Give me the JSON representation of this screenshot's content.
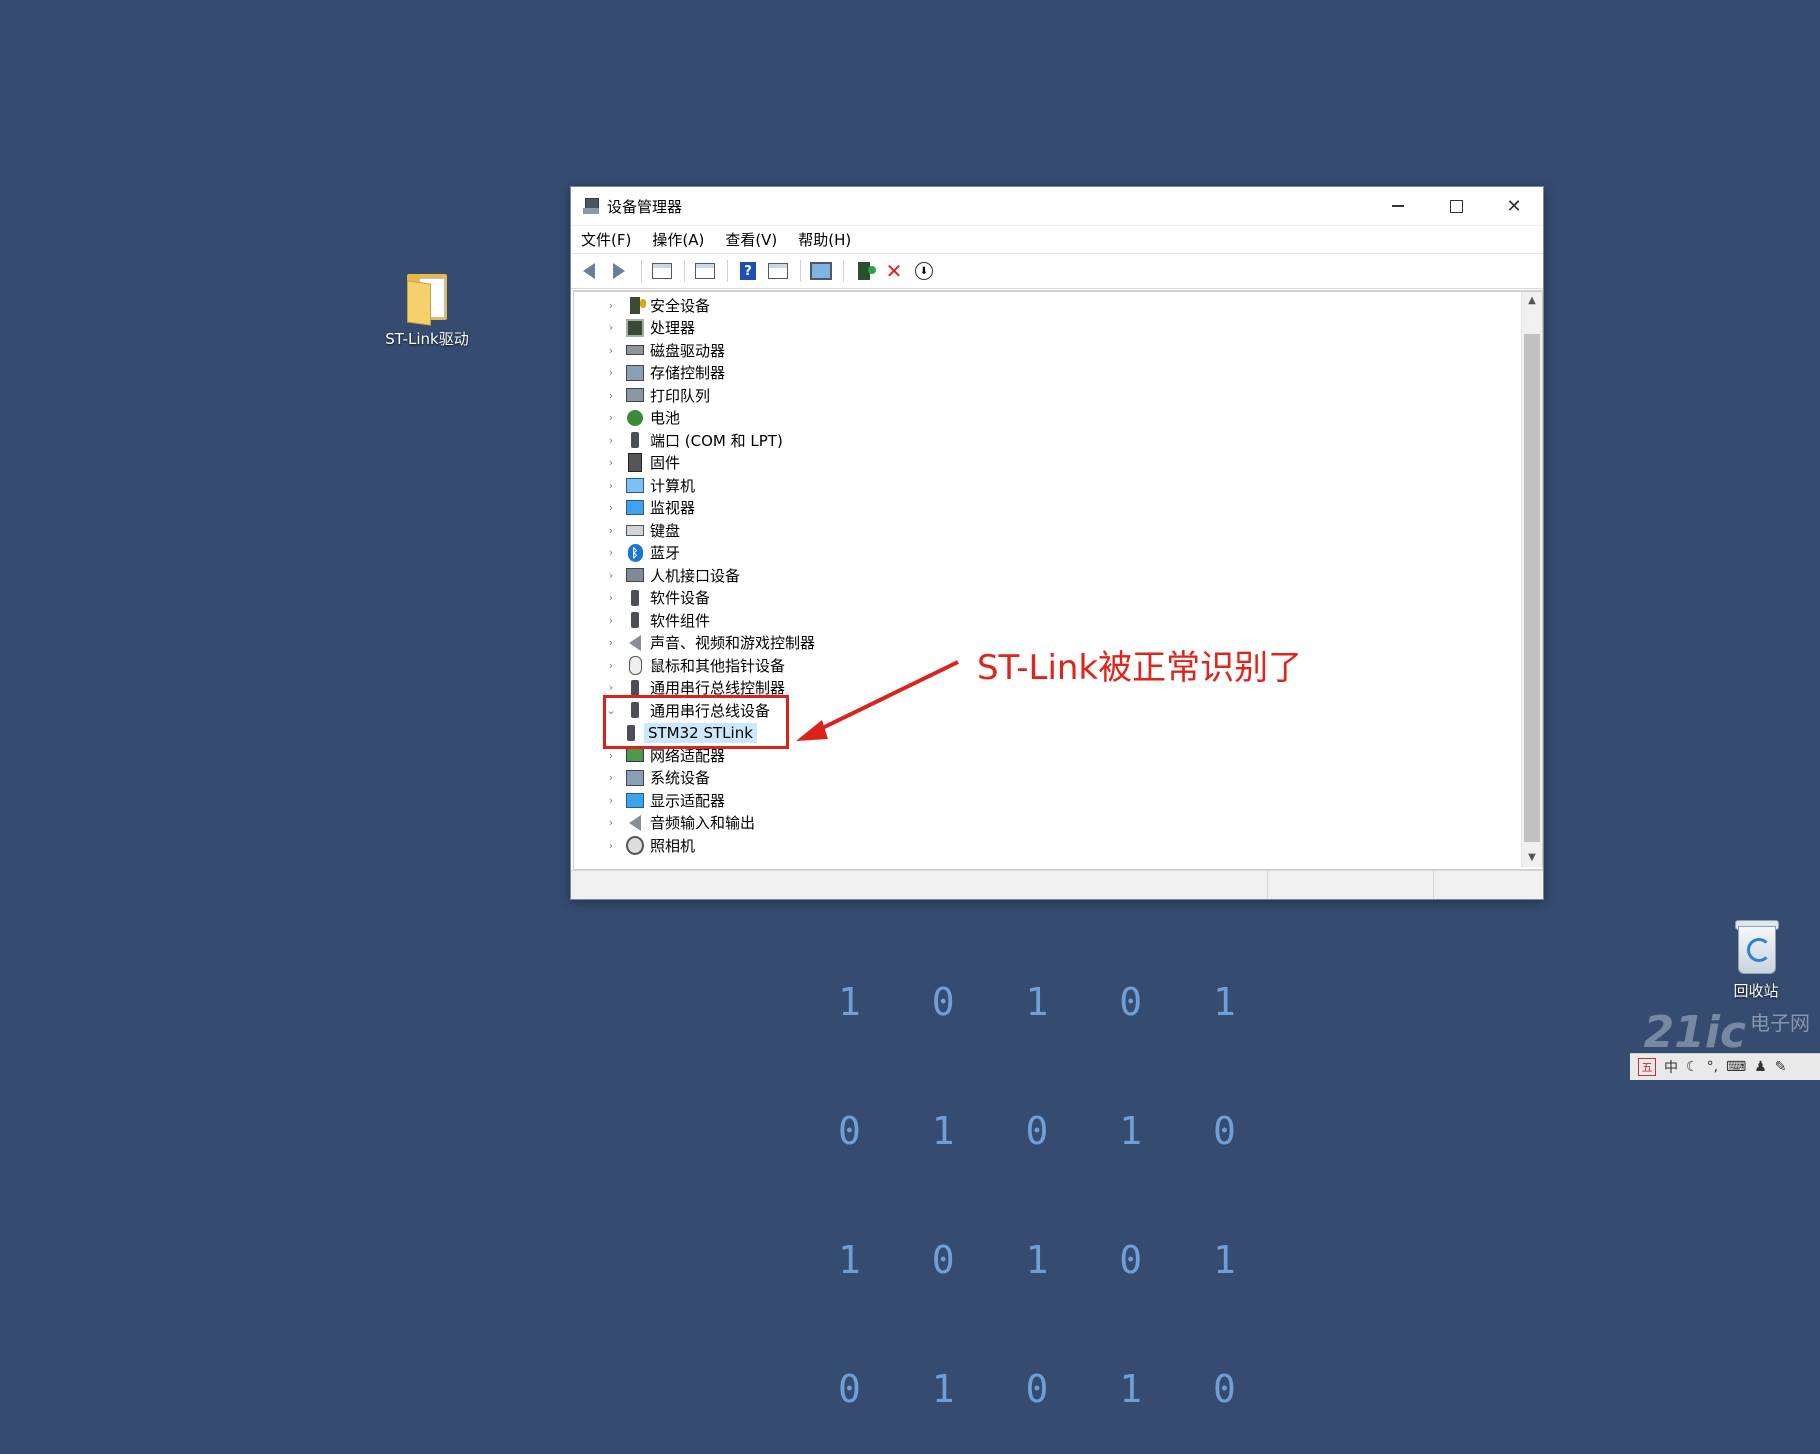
{
  "desktop": {
    "folder_label": "ST-Link驱动",
    "recycle_bin_label": "回收站",
    "binary_rows": [
      "1 0 1 0 1",
      "0 1 0 1 0",
      "1 0 1 0 1",
      "0 1 0 1 0"
    ]
  },
  "window": {
    "title": "设备管理器",
    "menu": [
      "文件(F)",
      "操作(A)",
      "查看(V)",
      "帮助(H)"
    ],
    "controls": {
      "minimize": "—",
      "maximize": "□",
      "close": "✕"
    },
    "toolbar_icons": [
      "back-icon",
      "forward-icon",
      "properties-icon",
      "update-icon",
      "help-icon",
      "view-icon",
      "scan-icon",
      "add-device-icon",
      "uninstall-icon",
      "download-icon"
    ],
    "tree": [
      {
        "label": "安全设备",
        "icon": "security-device-icon",
        "expanded": false
      },
      {
        "label": "处理器",
        "icon": "processor-icon",
        "expanded": false
      },
      {
        "label": "磁盘驱动器",
        "icon": "disk-drive-icon",
        "expanded": false
      },
      {
        "label": "存储控制器",
        "icon": "storage-controller-icon",
        "expanded": false
      },
      {
        "label": "打印队列",
        "icon": "print-queue-icon",
        "expanded": false
      },
      {
        "label": "电池",
        "icon": "battery-icon",
        "expanded": false
      },
      {
        "label": "端口 (COM 和 LPT)",
        "icon": "port-icon",
        "expanded": false
      },
      {
        "label": "固件",
        "icon": "firmware-icon",
        "expanded": false
      },
      {
        "label": "计算机",
        "icon": "computer-icon",
        "expanded": false
      },
      {
        "label": "监视器",
        "icon": "monitor-icon",
        "expanded": false
      },
      {
        "label": "键盘",
        "icon": "keyboard-icon",
        "expanded": false
      },
      {
        "label": "蓝牙",
        "icon": "bluetooth-icon",
        "expanded": false
      },
      {
        "label": "人机接口设备",
        "icon": "hid-icon",
        "expanded": false
      },
      {
        "label": "软件设备",
        "icon": "software-device-icon",
        "expanded": false
      },
      {
        "label": "软件组件",
        "icon": "software-component-icon",
        "expanded": false
      },
      {
        "label": "声音、视频和游戏控制器",
        "icon": "audio-icon",
        "expanded": false
      },
      {
        "label": "鼠标和其他指针设备",
        "icon": "mouse-icon",
        "expanded": false
      },
      {
        "label": "通用串行总线控制器",
        "icon": "usb-icon",
        "expanded": false
      },
      {
        "label": "通用串行总线设备",
        "icon": "usb-icon",
        "expanded": true,
        "children": [
          "STM32 STLink"
        ]
      },
      {
        "label": "网络适配器",
        "icon": "network-icon",
        "expanded": false
      },
      {
        "label": "系统设备",
        "icon": "system-device-icon",
        "expanded": false
      },
      {
        "label": "显示适配器",
        "icon": "display-adapter-icon",
        "expanded": false
      },
      {
        "label": "音频输入和输出",
        "icon": "audio-io-icon",
        "expanded": false
      },
      {
        "label": "照相机",
        "icon": "camera-icon",
        "expanded": false
      }
    ]
  },
  "annotation": {
    "text": "ST-Link被正常识别了",
    "color": "#e2231a"
  },
  "watermark": {
    "number": "21ic",
    "text": "电子网"
  },
  "tray": {
    "ime_label": "五",
    "lang": "中"
  }
}
